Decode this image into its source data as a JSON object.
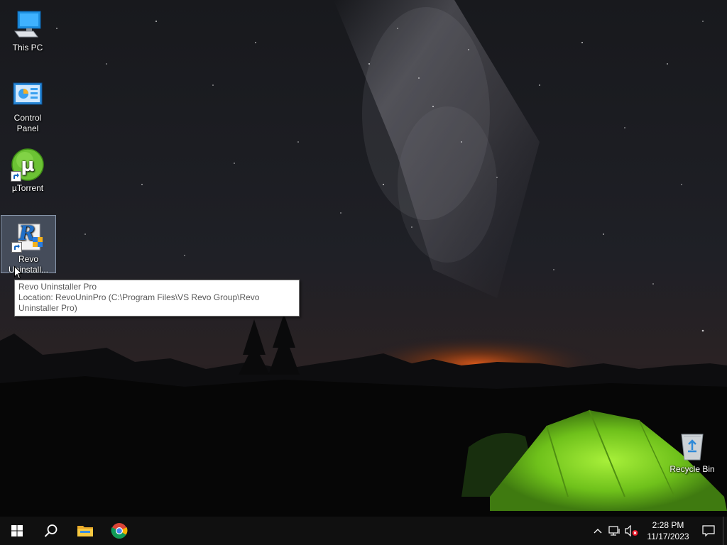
{
  "desktop": {
    "icons": [
      {
        "label": "This PC",
        "icon": "computer-icon"
      },
      {
        "label": "Control Panel",
        "icon": "control-panel-icon"
      },
      {
        "label": "µTorrent",
        "icon": "utorrent-icon"
      },
      {
        "label": "Revo Uninstall...",
        "icon": "revo-uninstaller-icon"
      },
      {
        "label": "Recycle Bin",
        "icon": "recycle-bin-icon"
      }
    ],
    "selected_icon": "Revo Uninstall..."
  },
  "tooltip": {
    "line1": "Revo Uninstaller Pro",
    "line2": "Location: RevoUninPro (C:\\Program Files\\VS Revo Group\\Revo Uninstaller Pro)"
  },
  "taskbar": {
    "start_icon": "windows-logo-icon",
    "search_icon": "search-icon",
    "pinned": [
      {
        "name": "File Explorer",
        "icon": "folder-icon"
      },
      {
        "name": "Google Chrome",
        "icon": "chrome-icon"
      }
    ],
    "tray_icons": [
      "chevron-up-icon",
      "network-icon",
      "volume-muted-icon"
    ],
    "clock": {
      "time": "2:28 PM",
      "date": "11/17/2023"
    },
    "notification_icon": "action-center-icon"
  },
  "colors": {
    "taskbar_bg": "#101010",
    "accent": "#76b9ed",
    "tent_green": "#7ed321"
  }
}
